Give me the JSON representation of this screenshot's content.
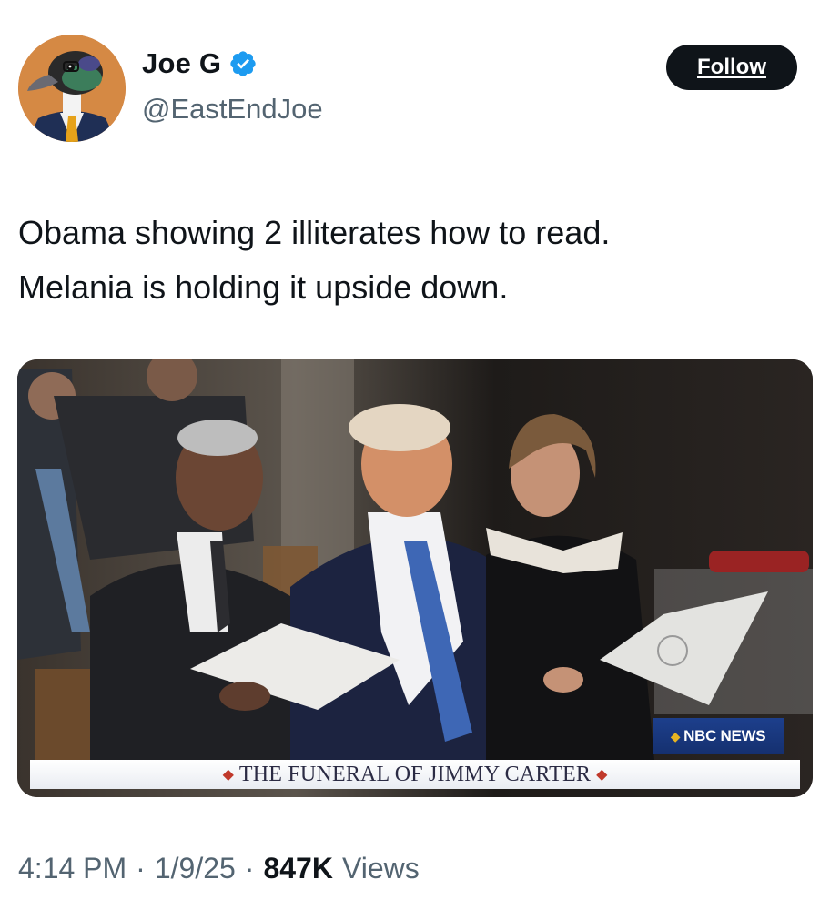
{
  "author": {
    "display_name": "Joe G",
    "handle": "@EastEndJoe",
    "verified": true,
    "avatar_icon": "duck-in-suit-avatar"
  },
  "follow_button": {
    "label": "Follow"
  },
  "tweet": {
    "lines": [
      "Obama showing 2 illiterates how to read.",
      "Melania is holding it upside down."
    ]
  },
  "media": {
    "network_badge": "NBC NEWS",
    "caption": "THE FUNERAL OF JIMMY CARTER"
  },
  "meta": {
    "time": "4:14 PM",
    "date": "1/9/25",
    "views_count": "847K",
    "views_label": "Views",
    "separator": "·"
  },
  "colors": {
    "text_primary": "#0f1419",
    "text_secondary": "#536471",
    "verified_blue": "#1d9bf0",
    "button_dark": "#0f1419"
  }
}
